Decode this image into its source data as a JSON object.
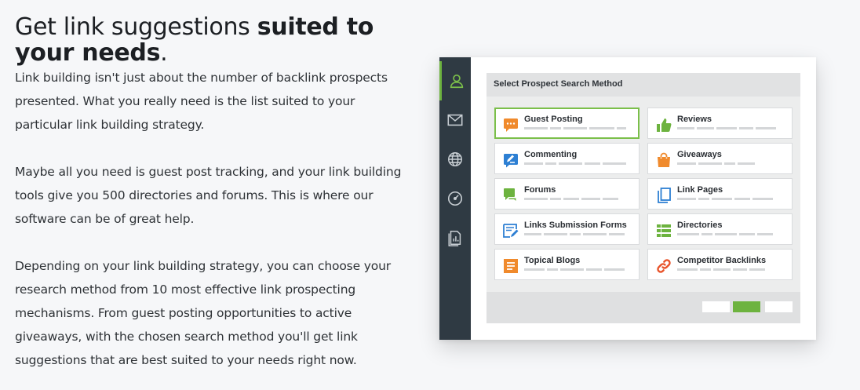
{
  "headline": {
    "normal": "Get link suggestions ",
    "bold": "suited to your needs",
    "end": "."
  },
  "paragraphs": [
    "Link building isn't just about the number of backlink prospects presented. What you really need is the list suited to your particular link building strategy.",
    "Maybe all you need is guest post tracking, and your link building tools give you 500 directories and forums. This is where our software can be of great help.",
    "Depending on your link building strategy, you can choose your research method from 10 most effective link prospecting mechanisms. From guest posting opportunities to active giveaways, with the chosen search method you'll get link suggestions that are best suited to your needs right now."
  ],
  "sidebar": {
    "items": [
      {
        "icon": "user-icon",
        "active": true
      },
      {
        "icon": "mail-icon",
        "active": false
      },
      {
        "icon": "globe-icon",
        "active": false
      },
      {
        "icon": "gauge-icon",
        "active": false
      },
      {
        "icon": "report-icon",
        "active": false
      }
    ]
  },
  "panel": {
    "title": "Select Prospect Search Method",
    "methods": [
      {
        "label": "Guest Posting",
        "icon": "chat-bubble-icon",
        "color": "#f08a2c",
        "selected": true
      },
      {
        "label": "Reviews",
        "icon": "thumbs-up-icon",
        "color": "#6db33f",
        "selected": false
      },
      {
        "label": "Commenting",
        "icon": "comment-pen-icon",
        "color": "#2d7fd3",
        "selected": false
      },
      {
        "label": "Giveaways",
        "icon": "shopping-bag-icon",
        "color": "#f08a2c",
        "selected": false
      },
      {
        "label": "Forums",
        "icon": "forum-icon",
        "color": "#6db33f",
        "selected": false
      },
      {
        "label": "Link Pages",
        "icon": "pages-icon",
        "color": "#2d7fd3",
        "selected": false
      },
      {
        "label": "Links Submission Forms",
        "icon": "form-edit-icon",
        "color": "#2d7fd3",
        "selected": false
      },
      {
        "label": "Directories",
        "icon": "list-grid-icon",
        "color": "#6db33f",
        "selected": false
      },
      {
        "label": "Topical Blogs",
        "icon": "document-icon",
        "color": "#f08a2c",
        "selected": false
      },
      {
        "label": "Competitor Backlinks",
        "icon": "link-chain-icon",
        "color": "#e8532a",
        "selected": false
      }
    ]
  },
  "colors": {
    "accent": "#6db33f",
    "rail": "#2f3a43",
    "orange": "#f08a2c",
    "blue": "#2d7fd3"
  }
}
